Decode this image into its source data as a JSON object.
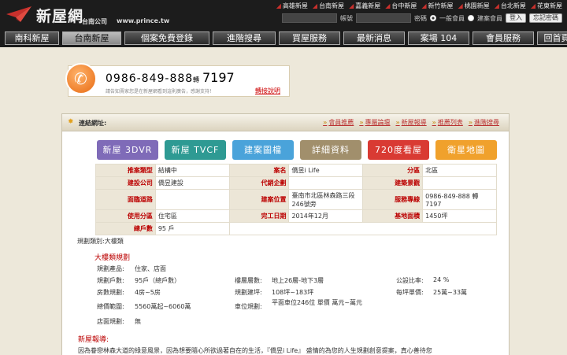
{
  "logo": {
    "name": "新屋網",
    "sub": "台南公司",
    "url": "www.prince.tw"
  },
  "regions": [
    "高雄新屋",
    "台南新屋",
    "嘉義新屋",
    "台中新屋",
    "新竹新屋",
    "桃園新屋",
    "台北新屋",
    "花東新屋"
  ],
  "login": {
    "account_label": "帳號",
    "password_label": "密碼",
    "member_option": "一般會員",
    "builder_option": "建案會員",
    "login_button": "登入",
    "forgot_button": "忘記密碼"
  },
  "nav": [
    {
      "label": "南科新屋"
    },
    {
      "label": "台南新屋"
    },
    {
      "label": "個案免費登錄"
    },
    {
      "label": "進階搜尋"
    },
    {
      "label": "買屋服務"
    },
    {
      "label": "最新消息"
    },
    {
      "label": "案場 104"
    },
    {
      "label": "會員服務"
    },
    {
      "label": "回首頁"
    }
  ],
  "ad": {
    "phone": "0986-849-888",
    "ext_label": "轉",
    "ext": "7197",
    "note": "請告知賣家您是在新屋網看到這則廣告，感謝支持！",
    "link": "轉接說明"
  },
  "panel": {
    "link_label": "連結網址:",
    "links": [
      "會員推薦",
      "專屬論壇",
      "新屋報導",
      "推薦列表",
      "進階搜尋"
    ],
    "buttons": [
      {
        "label": "新屋 3DVR",
        "color": "#7f6bb8"
      },
      {
        "label": "新屋 TVCF",
        "color": "#2e9a93"
      },
      {
        "label": "建案圖檔",
        "color": "#4aa3da"
      },
      {
        "label": "詳細資料",
        "color": "#a18f6c"
      },
      {
        "label": "720度看屋",
        "color": "#d93a33"
      },
      {
        "label": "衛星地圖",
        "color": "#f0a12c"
      }
    ]
  },
  "table": {
    "r1": {
      "k1": "推案類型",
      "v1": "結構中",
      "k2": "案名",
      "v2": "僑昱i Life",
      "k3": "分區",
      "v3": "北區"
    },
    "r2": {
      "k1": "建設公司",
      "v1": "僑昱建設",
      "k2": "代銷企劃",
      "v2": "",
      "k3": "建築景觀",
      "v3": ""
    },
    "r3": {
      "k1": "面臨道路",
      "v1": "",
      "k2": "建案位置",
      "v2": "臺南市北區林森路三段246號旁",
      "k3": "服務專線",
      "v3": "0986-849-888 轉7197"
    },
    "r4": {
      "k1": "使用分區",
      "v1": "住宅區",
      "k2": "完工日期",
      "v2": "2014年12月",
      "k3": "基地面積",
      "v3": "1450坪"
    },
    "r5": {
      "k1": "總戶數",
      "v1": "95 戶"
    }
  },
  "plan": {
    "title": "規劃類別:大樓類",
    "section": "大樓類規劃",
    "product_label": "規劃產品:",
    "product": "住家、店面",
    "units_label": "規劃戶數:",
    "units": "95戶（總戶數）",
    "floors_label": "樓層層數:",
    "floors": "地上26層-地下3層",
    "ratio_label": "公設比率:",
    "ratio": "24 %",
    "rooms_label": "房數規劃:",
    "rooms": "4房~5房",
    "area_label": "規劃建坪:",
    "area": "108坪~183坪",
    "price_label": "每坪單價:",
    "price": "25萬~33萬",
    "total_label": "總價範圍:",
    "total": "5560萬起~6060萬",
    "parking_label": "車位規劃:",
    "parking": "平面車位246位 單價 萬元~萬元",
    "shop_label": "店面規劃:",
    "shop": "無"
  },
  "news": {
    "title": "新屋報導:",
    "text": "因為眷戀林森大道的綠意風景，因為想要隨心所欲過著自在的生活，『僑昱i Life』 盛情的為您的人生規劃創意提案，真心善待您"
  }
}
